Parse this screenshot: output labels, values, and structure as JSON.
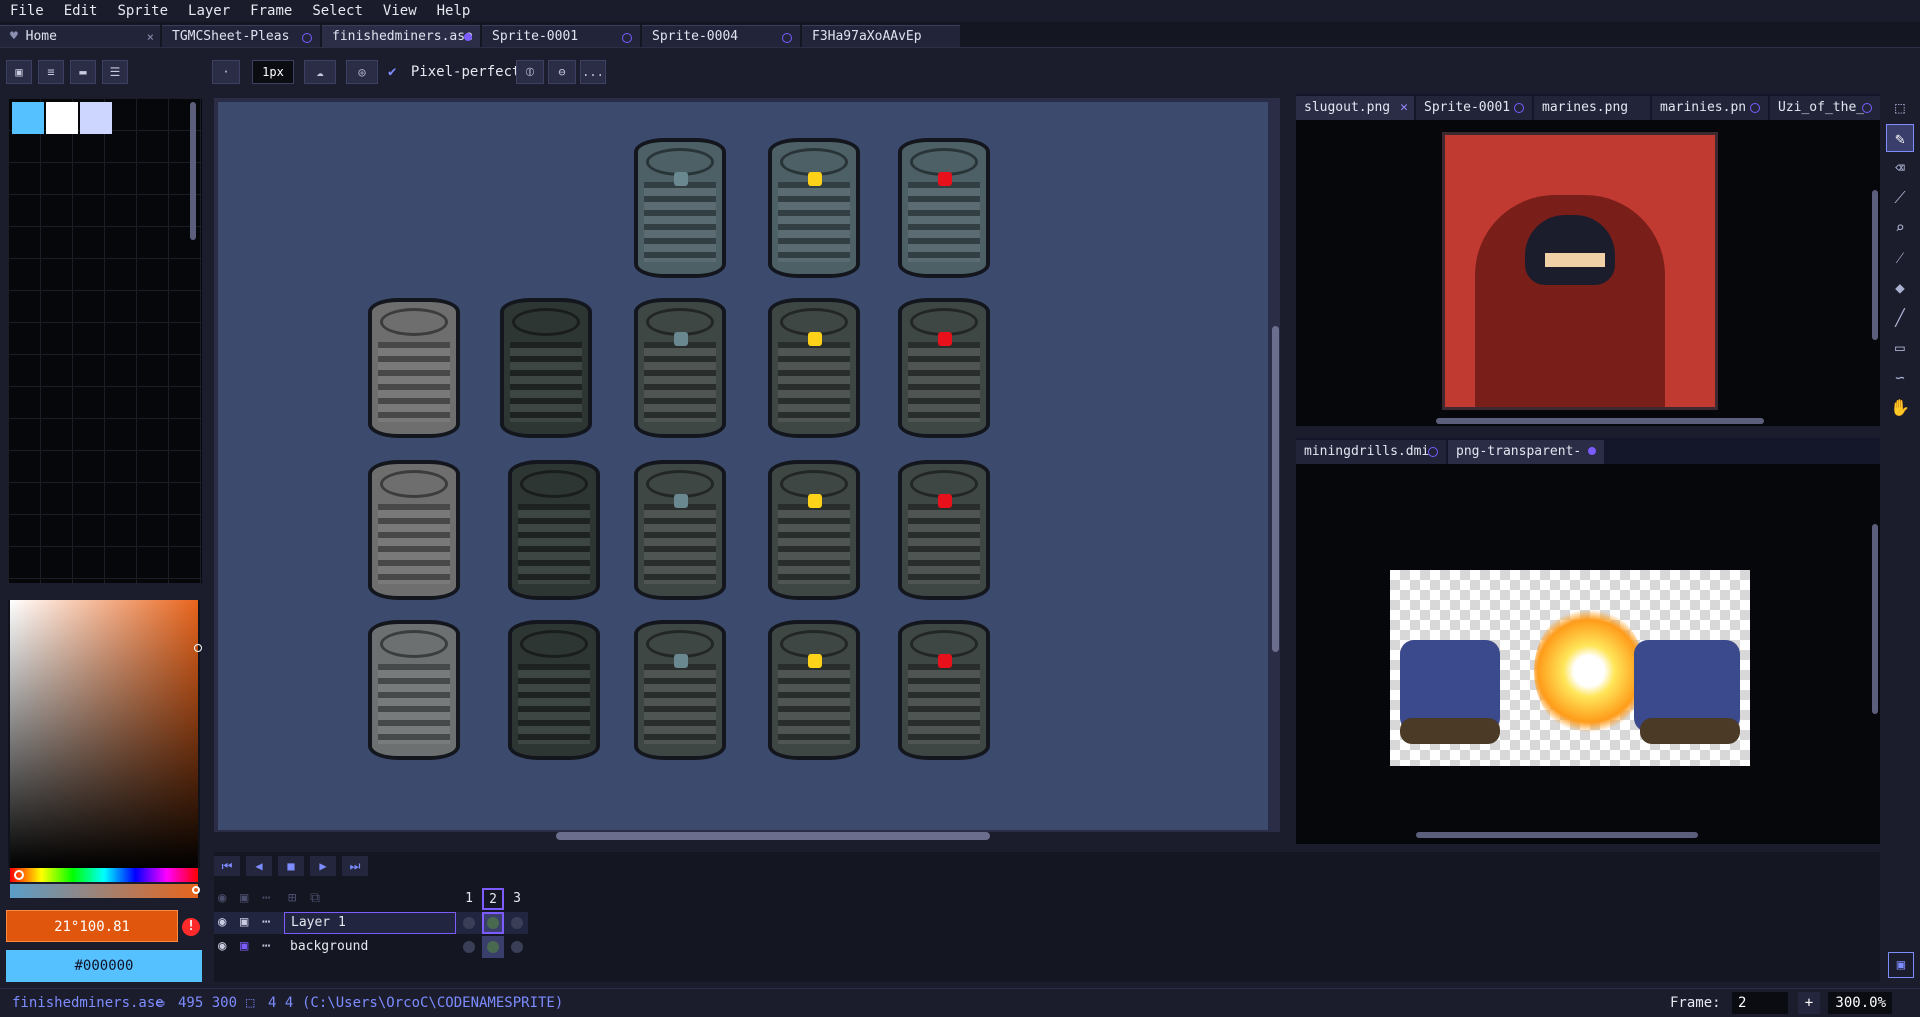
{
  "menu": [
    "File",
    "Edit",
    "Sprite",
    "Layer",
    "Frame",
    "Select",
    "View",
    "Help"
  ],
  "tabs": [
    {
      "label": "Home",
      "close": "×"
    },
    {
      "label": "TGMCSheet-Pleas"
    },
    {
      "label": "finishedminers.ase"
    },
    {
      "label": "Sprite-0001"
    },
    {
      "label": "Sprite-0004"
    },
    {
      "label": "F3Ha97aXoAAvEp"
    }
  ],
  "toolbar": {
    "brush_size": "1px",
    "pixel_perfect": "Pixel-perfect",
    "more": "..."
  },
  "palette": {
    "swatches": [
      "#55c1ff",
      "#ffffff",
      "#ccd6ff"
    ]
  },
  "color": {
    "foreground": "21°100.81",
    "background": "#000000",
    "fg_hex": "#e0560c",
    "bg_hex": "#55c1ff",
    "warning": "!"
  },
  "preview_top": {
    "tabs": [
      {
        "label": "slugout.png"
      },
      {
        "label": "Sprite-0001"
      },
      {
        "label": "marines.png"
      },
      {
        "label": "marinies.pn"
      },
      {
        "label": "Uzi_of_the_"
      }
    ]
  },
  "preview_bottom": {
    "tabs": [
      {
        "label": "miningdrills.dmi"
      },
      {
        "label": "png-transparent-"
      }
    ]
  },
  "sprite_lights": {
    "row_top": [
      "#6a8890",
      "#ffd21a",
      "#e8101a"
    ],
    "row2": [
      "#6a8890",
      "#ffd21a",
      "#e8101a"
    ],
    "row3": [
      "#6a8890",
      "#ffd21a",
      "#e8101a"
    ],
    "row4": [
      "#6a8890",
      "#ffd21a",
      "#e8101a"
    ]
  },
  "timeline": {
    "frames": [
      "1",
      "2",
      "3"
    ],
    "layers": [
      {
        "name": "Layer 1"
      },
      {
        "name": "background"
      }
    ]
  },
  "status": {
    "filename": "finishedminers.ase",
    "size": "495 300",
    "grid": "4 4",
    "path": "(C:\\Users\\OrcoC\\CODENAMESPRITE)",
    "frame_label": "Frame:",
    "frame_value": "2",
    "add": "+",
    "zoom": "300.0%"
  }
}
